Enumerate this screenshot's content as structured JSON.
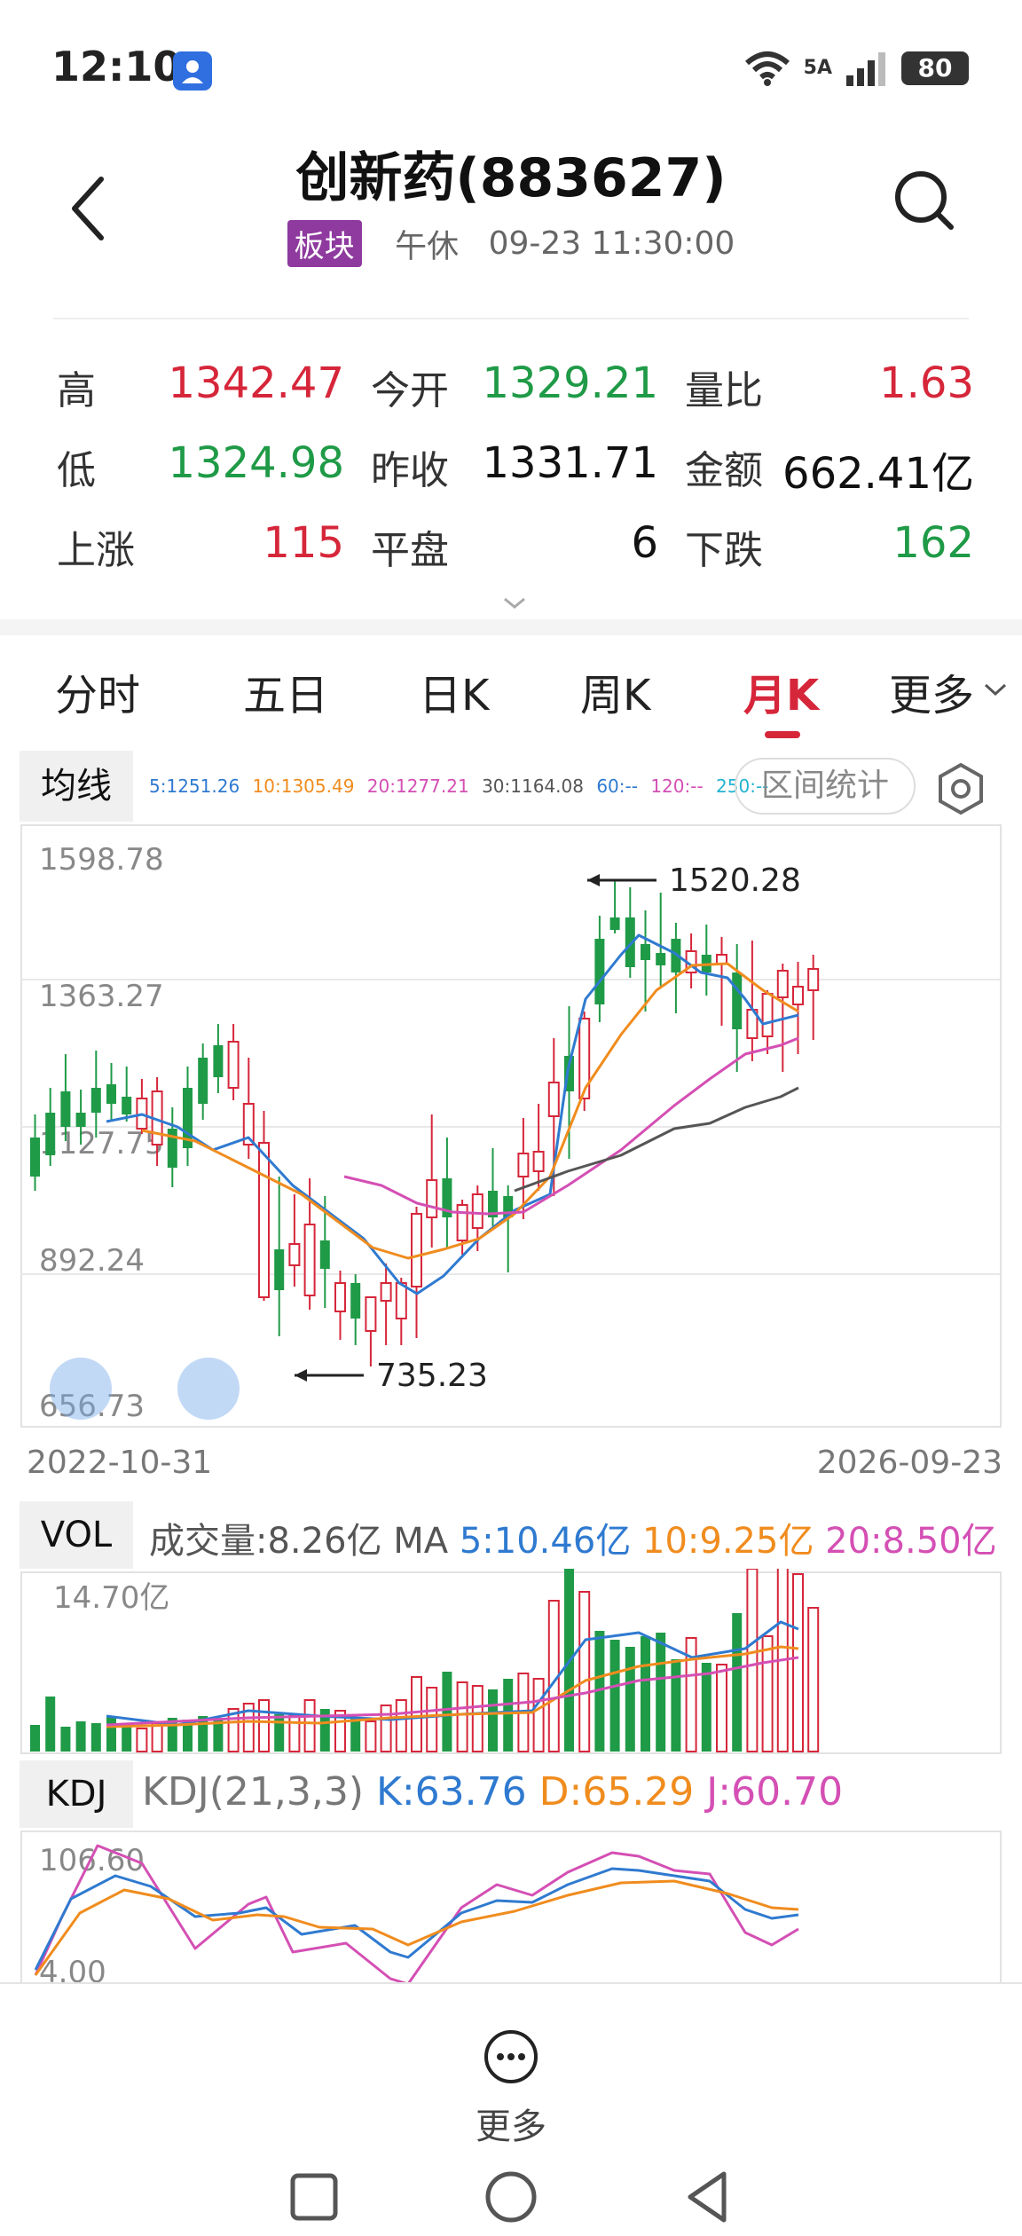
{
  "status_bar": {
    "time": "12:10",
    "network": "5A",
    "battery": "80"
  },
  "header": {
    "title": "创新药(883627)",
    "badge": "板块",
    "session": "午休",
    "datetime": "09-23  11:30:00"
  },
  "quote": {
    "rows": [
      [
        {
          "label": "高",
          "value": "1342.47",
          "color": "red"
        },
        {
          "label": "今开",
          "value": "1329.21",
          "color": "green"
        },
        {
          "label": "量比",
          "value": "1.63",
          "color": "red"
        }
      ],
      [
        {
          "label": "低",
          "value": "1324.98",
          "color": "green"
        },
        {
          "label": "昨收",
          "value": "1331.71",
          "color": "black"
        },
        {
          "label": "金额",
          "value": "662.41亿",
          "color": "black"
        }
      ],
      [
        {
          "label": "上涨",
          "value": "115",
          "color": "red"
        },
        {
          "label": "平盘",
          "value": "6",
          "color": "black"
        },
        {
          "label": "下跌",
          "value": "162",
          "color": "green"
        }
      ]
    ]
  },
  "tabs": {
    "items": [
      "分时",
      "五日",
      "日K",
      "周K",
      "月K",
      "更多"
    ],
    "active": "月K"
  },
  "ma_bar": {
    "badge": "均线",
    "values": [
      {
        "text": "5:1251.26",
        "color": "#2f7ad0"
      },
      {
        "text": "10:1305.49",
        "color": "#f08c1e"
      },
      {
        "text": "20:1277.21",
        "color": "#d44fb4"
      },
      {
        "text": "30:1164.08",
        "color": "#555555"
      },
      {
        "text": "60:--",
        "color": "#2f7ad0"
      },
      {
        "text": "120:--",
        "color": "#d44fb4"
      },
      {
        "text": "250:--",
        "color": "#22b3d1"
      }
    ],
    "range_button": "区间统计"
  },
  "main_chart": {
    "axis_labels": [
      "1598.78",
      "1363.27",
      "1127.75",
      "892.24",
      "656.73"
    ],
    "high_label": "1520.28",
    "low_label": "735.23",
    "start_date": "2022-10-31",
    "end_date": "2026-09-23"
  },
  "volume": {
    "badge": "VOL",
    "prefix": "成交量:8.26亿 MA ",
    "ma5": "5:10.46亿",
    "ma10": "10:9.25亿",
    "ma20": "20:8.50亿",
    "axis_label": "14.70亿"
  },
  "kdj": {
    "badge": "KDJ",
    "params": "KDJ(21,3,3) ",
    "k": "K:63.76",
    "d": "D:65.29",
    "j": "J:60.70",
    "axis_top": "106.60",
    "axis_bottom": "4.00"
  },
  "bottom": {
    "more_label": "更多"
  },
  "colors": {
    "up": "#d6263a",
    "down": "#1f9a47",
    "ma5": "#2f7ad0",
    "ma10": "#f08c1e",
    "ma20": "#d44fb4",
    "ma30": "#555555"
  }
}
